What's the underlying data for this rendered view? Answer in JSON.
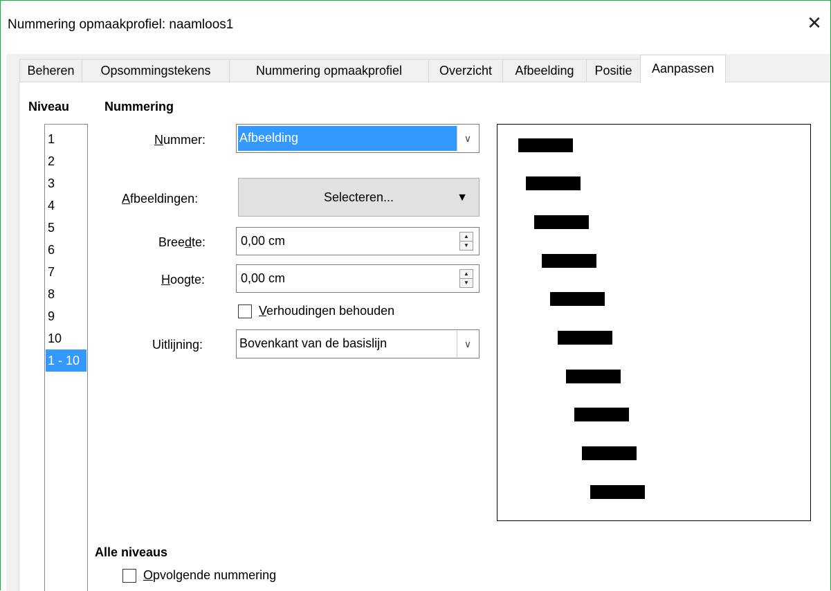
{
  "window": {
    "title": "Nummering opmaakprofiel: naamloos1",
    "close_glyph": "✕"
  },
  "tabs": [
    {
      "label": "Beheren",
      "active": false
    },
    {
      "label": "Opsommingstekens",
      "active": false
    },
    {
      "label": "Nummering opmaakprofiel",
      "active": false
    },
    {
      "label": "Overzicht",
      "active": false
    },
    {
      "label": "Afbeelding",
      "active": false
    },
    {
      "label": "Positie",
      "active": false
    },
    {
      "label": "Aanpassen",
      "active": true
    }
  ],
  "level": {
    "heading": "Niveau",
    "items": [
      "1",
      "2",
      "3",
      "4",
      "5",
      "6",
      "7",
      "8",
      "9",
      "10",
      "1 - 10"
    ],
    "selected": "1 - 10"
  },
  "numbering": {
    "heading": "Nummering",
    "number_label": {
      "mnemonic": "N",
      "rest": "ummer:"
    },
    "number_value": "Afbeelding",
    "images_label": {
      "mnemonic": "A",
      "rest": "fbeeldingen:"
    },
    "select_button": "Selecteren...",
    "width_label": {
      "pre": "Bree",
      "mnemonic": "d",
      "post": "te:"
    },
    "width_value": "0,00 cm",
    "height_label": {
      "mnemonic": "H",
      "rest": "oogte:"
    },
    "height_value": "0,00 cm",
    "keep_ratio": {
      "mnemonic": "V",
      "rest": "erhoudingen behouden",
      "checked": false
    },
    "alignment_label": {
      "pre": "Uitli",
      "mnemonic": "j",
      "post": "ning:"
    },
    "alignment_value": "Bovenkant van de basislijn"
  },
  "all_levels": {
    "heading": "Alle niveaus",
    "consecutive": {
      "mnemonic": "O",
      "rest": "pvolgende nummering",
      "checked": false
    }
  },
  "preview": {
    "bar_color": "#000000",
    "levels": 10
  },
  "colors": {
    "selection": "#3399ff",
    "window_border": "#1aaa3c"
  }
}
